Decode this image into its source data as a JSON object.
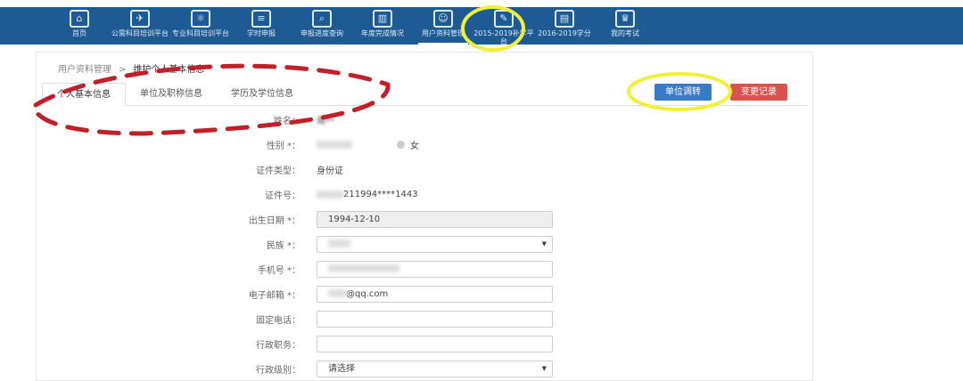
{
  "nav": [
    {
      "label": "首页",
      "icon": "home-icon"
    },
    {
      "label": "公需科目培训平台",
      "icon": "plane-board-icon"
    },
    {
      "label": "专业科目培训平台",
      "icon": "atom-icon"
    },
    {
      "label": "学时申报",
      "icon": "document-icon"
    },
    {
      "label": "申报进度查询",
      "icon": "search-icon"
    },
    {
      "label": "年度完成情况",
      "icon": "books-icon"
    },
    {
      "label": "用户资料管理",
      "icon": "user-card-icon",
      "active": true
    },
    {
      "label": "2015-2019补学平台",
      "icon": "note-icon"
    },
    {
      "label": "2016-2019学分",
      "icon": "clipboard-icon"
    },
    {
      "label": "我的考试",
      "icon": "graduate-icon"
    }
  ],
  "breadcrumb": {
    "parent": "用户资料管理",
    "sep": ">",
    "current": "维护个人基本信息"
  },
  "tabs": [
    "个人基本信息",
    "单位及职称信息",
    "学历及学位信息"
  ],
  "buttons": {
    "transfer": "单位调转",
    "history": "变更记录"
  },
  "form": {
    "name": {
      "label": "姓名：",
      "value": "周**"
    },
    "gender": {
      "label": "性别 *：",
      "option_female": "女"
    },
    "id_type": {
      "label": "证件类型：",
      "value": "身份证"
    },
    "id_no": {
      "label": "证件号：",
      "value": "211994****1443"
    },
    "birth": {
      "label": "出生日期 *：",
      "value": "1994-12-10"
    },
    "ethnic": {
      "label": "民族 *："
    },
    "phone": {
      "label": "手机号 *："
    },
    "email": {
      "label": "电子邮箱 *：",
      "value": "@qq.com"
    },
    "landline": {
      "label": "固定电话：",
      "value": ""
    },
    "admin_post": {
      "label": "行政职务：",
      "value": ""
    },
    "admin_level": {
      "label": "行政级别：",
      "value": "请选择"
    }
  }
}
